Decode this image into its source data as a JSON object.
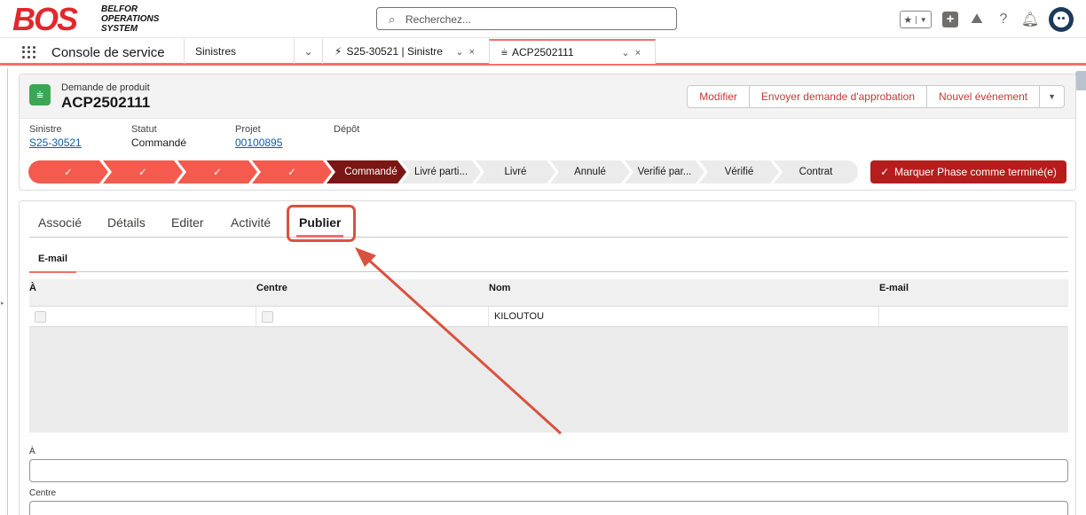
{
  "header": {
    "logo_text": "BOS",
    "logo_sub": [
      "BELFOR",
      "OPERATIONS",
      "SYSTEM"
    ],
    "search_placeholder": "Recherchez..."
  },
  "nav": {
    "app_name": "Console de service",
    "tabs": [
      {
        "label": "Sinistres"
      },
      {
        "label": "S25-30521 | Sinistre"
      },
      {
        "label": "ACP2502111"
      }
    ]
  },
  "record": {
    "type": "Demande de produit",
    "name": "ACP2502111",
    "actions": [
      "Modifier",
      "Envoyer demande d'approbation",
      "Nouvel événement"
    ],
    "fields": [
      {
        "label": "Sinistre",
        "value": "S25-30521"
      },
      {
        "label": "Statut",
        "value": "Commandé"
      },
      {
        "label": "Projet",
        "value": "00100895"
      },
      {
        "label": "Dépôt",
        "value": ""
      }
    ],
    "path": {
      "completed_mark": "✓",
      "current": "Commandé",
      "upcoming": [
        "Livré parti...",
        "Livré",
        "Annulé",
        "Verifié par...",
        "Vérifié",
        "Contrat"
      ],
      "mark_button": "Marquer Phase comme terminé(e)"
    }
  },
  "tabs": {
    "items": [
      "Associé",
      "Détails",
      "Editer",
      "Activité",
      "Publier"
    ],
    "active": "Publier",
    "subtab": "E-mail"
  },
  "table": {
    "headers": [
      "À",
      "Centre",
      "Nom",
      "E-mail"
    ],
    "rows": [
      {
        "nom": "KILOUTOU",
        "email": ""
      }
    ]
  },
  "form": {
    "a_label": "À",
    "centre_label": "Centre"
  },
  "colors": {
    "accent": "#f26f6a",
    "path_done": "#f45b4e",
    "path_current": "#7a1714",
    "brand_red": "#e3272b",
    "annotation": "#d9523f"
  }
}
